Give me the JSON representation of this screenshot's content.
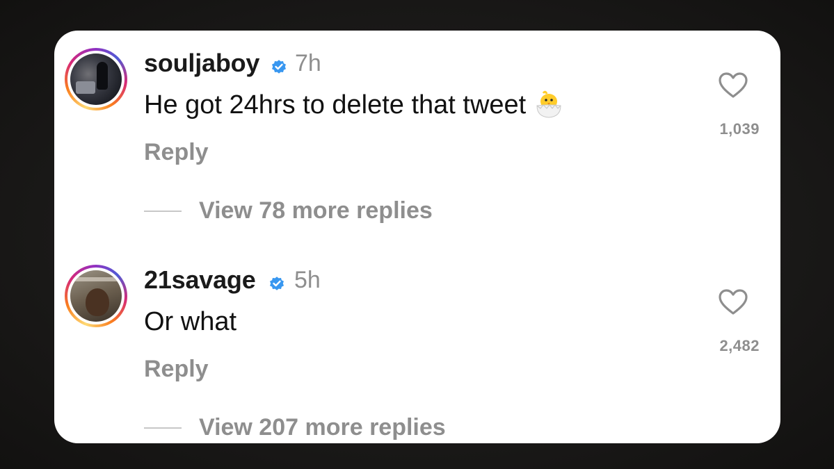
{
  "comments": [
    {
      "username": "souljaboy",
      "timestamp": "7h",
      "text": "He got 24hrs to delete that tweet",
      "emoji": "hatching-chick",
      "reply_label": "Reply",
      "like_count": "1,039",
      "view_replies": "View 78 more replies"
    },
    {
      "username": "21savage",
      "timestamp": "5h",
      "text": "Or what",
      "reply_label": "Reply",
      "like_count": "2,482",
      "view_replies": "View 207 more replies"
    }
  ],
  "colors": {
    "verified": "#3897f0",
    "muted": "#8e8e8e",
    "text": "#111111",
    "card": "#ffffff"
  }
}
